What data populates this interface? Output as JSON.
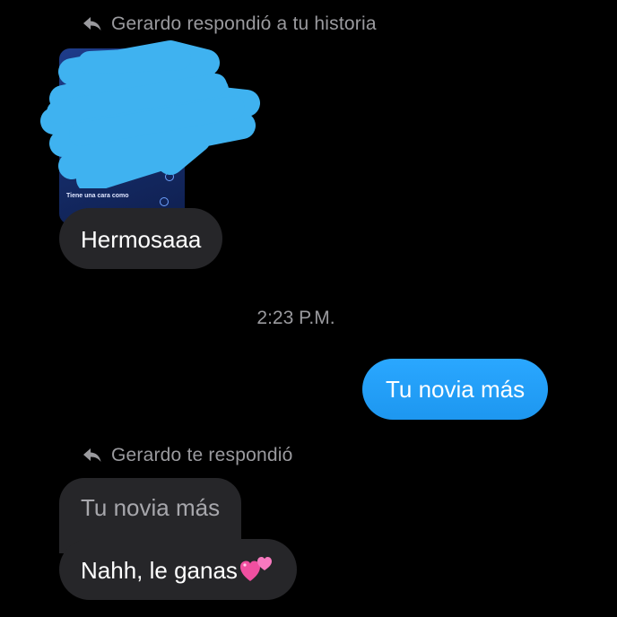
{
  "story_reply": {
    "header": "Gerardo respondió a tu historia",
    "thumbnail_caption": "Tiene una cara como",
    "message": "Hermosaaa"
  },
  "timestamp": "2:23 P.M.",
  "sent_message": "Tu novia más",
  "reply_thread": {
    "header": "Gerardo te respondió",
    "quoted_message": "Tu novia más",
    "message": "Nahh, le ganas"
  },
  "icons": {
    "reply": "reply-arrow-icon",
    "emoji": "two-hearts-emoji-icon"
  },
  "colors": {
    "background": "#000000",
    "incoming_bubble": "#262629",
    "outgoing_bubble": "#1d97f0",
    "meta_text": "#9a9a9e",
    "scribble": "#3fb2f0"
  }
}
